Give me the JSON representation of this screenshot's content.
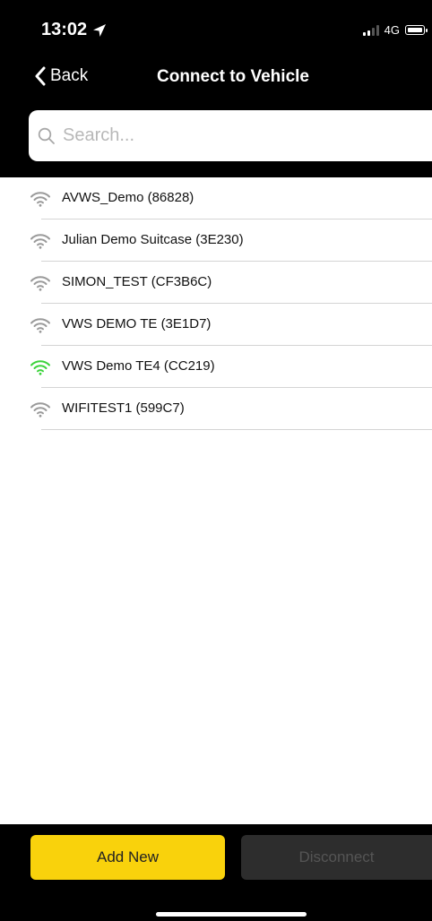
{
  "status_bar": {
    "time": "13:02",
    "network": "4G",
    "location_icon": "location-arrow-icon",
    "signal_icon": "cellular-signal-icon",
    "battery_icon": "battery-icon"
  },
  "nav": {
    "back_label": "Back",
    "title": "Connect to Vehicle"
  },
  "search": {
    "placeholder": "Search...",
    "value": ""
  },
  "vehicles": [
    {
      "label": "AVWS_Demo (86828)",
      "connected": false
    },
    {
      "label": "Julian Demo Suitcase (3E230)",
      "connected": false
    },
    {
      "label": "SIMON_TEST (CF3B6C)",
      "connected": false
    },
    {
      "label": "VWS DEMO TE (3E1D7)",
      "connected": false
    },
    {
      "label": "VWS Demo TE4 (CC219)",
      "connected": true
    },
    {
      "label": "WIFITEST1 (599C7)",
      "connected": false
    }
  ],
  "colors": {
    "accent": "#f9d20c",
    "connected": "#3bd33b",
    "disconnected": "#9a9a9a"
  },
  "actions": {
    "add_label": "Add New",
    "disconnect_label": "Disconnect"
  }
}
